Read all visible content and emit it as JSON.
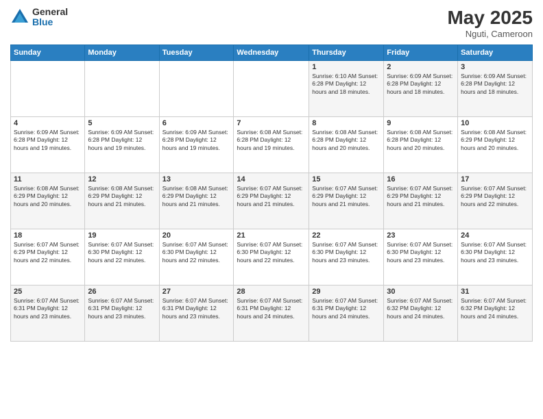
{
  "logo": {
    "general": "General",
    "blue": "Blue"
  },
  "header": {
    "month_year": "May 2025",
    "location": "Nguti, Cameroon"
  },
  "weekdays": [
    "Sunday",
    "Monday",
    "Tuesday",
    "Wednesday",
    "Thursday",
    "Friday",
    "Saturday"
  ],
  "weeks": [
    [
      {
        "day": "",
        "info": ""
      },
      {
        "day": "",
        "info": ""
      },
      {
        "day": "",
        "info": ""
      },
      {
        "day": "",
        "info": ""
      },
      {
        "day": "1",
        "info": "Sunrise: 6:10 AM\nSunset: 6:28 PM\nDaylight: 12 hours\nand 18 minutes."
      },
      {
        "day": "2",
        "info": "Sunrise: 6:09 AM\nSunset: 6:28 PM\nDaylight: 12 hours\nand 18 minutes."
      },
      {
        "day": "3",
        "info": "Sunrise: 6:09 AM\nSunset: 6:28 PM\nDaylight: 12 hours\nand 18 minutes."
      }
    ],
    [
      {
        "day": "4",
        "info": "Sunrise: 6:09 AM\nSunset: 6:28 PM\nDaylight: 12 hours\nand 19 minutes."
      },
      {
        "day": "5",
        "info": "Sunrise: 6:09 AM\nSunset: 6:28 PM\nDaylight: 12 hours\nand 19 minutes."
      },
      {
        "day": "6",
        "info": "Sunrise: 6:09 AM\nSunset: 6:28 PM\nDaylight: 12 hours\nand 19 minutes."
      },
      {
        "day": "7",
        "info": "Sunrise: 6:08 AM\nSunset: 6:28 PM\nDaylight: 12 hours\nand 19 minutes."
      },
      {
        "day": "8",
        "info": "Sunrise: 6:08 AM\nSunset: 6:28 PM\nDaylight: 12 hours\nand 20 minutes."
      },
      {
        "day": "9",
        "info": "Sunrise: 6:08 AM\nSunset: 6:28 PM\nDaylight: 12 hours\nand 20 minutes."
      },
      {
        "day": "10",
        "info": "Sunrise: 6:08 AM\nSunset: 6:29 PM\nDaylight: 12 hours\nand 20 minutes."
      }
    ],
    [
      {
        "day": "11",
        "info": "Sunrise: 6:08 AM\nSunset: 6:29 PM\nDaylight: 12 hours\nand 20 minutes."
      },
      {
        "day": "12",
        "info": "Sunrise: 6:08 AM\nSunset: 6:29 PM\nDaylight: 12 hours\nand 21 minutes."
      },
      {
        "day": "13",
        "info": "Sunrise: 6:08 AM\nSunset: 6:29 PM\nDaylight: 12 hours\nand 21 minutes."
      },
      {
        "day": "14",
        "info": "Sunrise: 6:07 AM\nSunset: 6:29 PM\nDaylight: 12 hours\nand 21 minutes."
      },
      {
        "day": "15",
        "info": "Sunrise: 6:07 AM\nSunset: 6:29 PM\nDaylight: 12 hours\nand 21 minutes."
      },
      {
        "day": "16",
        "info": "Sunrise: 6:07 AM\nSunset: 6:29 PM\nDaylight: 12 hours\nand 21 minutes."
      },
      {
        "day": "17",
        "info": "Sunrise: 6:07 AM\nSunset: 6:29 PM\nDaylight: 12 hours\nand 22 minutes."
      }
    ],
    [
      {
        "day": "18",
        "info": "Sunrise: 6:07 AM\nSunset: 6:29 PM\nDaylight: 12 hours\nand 22 minutes."
      },
      {
        "day": "19",
        "info": "Sunrise: 6:07 AM\nSunset: 6:30 PM\nDaylight: 12 hours\nand 22 minutes."
      },
      {
        "day": "20",
        "info": "Sunrise: 6:07 AM\nSunset: 6:30 PM\nDaylight: 12 hours\nand 22 minutes."
      },
      {
        "day": "21",
        "info": "Sunrise: 6:07 AM\nSunset: 6:30 PM\nDaylight: 12 hours\nand 22 minutes."
      },
      {
        "day": "22",
        "info": "Sunrise: 6:07 AM\nSunset: 6:30 PM\nDaylight: 12 hours\nand 23 minutes."
      },
      {
        "day": "23",
        "info": "Sunrise: 6:07 AM\nSunset: 6:30 PM\nDaylight: 12 hours\nand 23 minutes."
      },
      {
        "day": "24",
        "info": "Sunrise: 6:07 AM\nSunset: 6:30 PM\nDaylight: 12 hours\nand 23 minutes."
      }
    ],
    [
      {
        "day": "25",
        "info": "Sunrise: 6:07 AM\nSunset: 6:31 PM\nDaylight: 12 hours\nand 23 minutes."
      },
      {
        "day": "26",
        "info": "Sunrise: 6:07 AM\nSunset: 6:31 PM\nDaylight: 12 hours\nand 23 minutes."
      },
      {
        "day": "27",
        "info": "Sunrise: 6:07 AM\nSunset: 6:31 PM\nDaylight: 12 hours\nand 23 minutes."
      },
      {
        "day": "28",
        "info": "Sunrise: 6:07 AM\nSunset: 6:31 PM\nDaylight: 12 hours\nand 24 minutes."
      },
      {
        "day": "29",
        "info": "Sunrise: 6:07 AM\nSunset: 6:31 PM\nDaylight: 12 hours\nand 24 minutes."
      },
      {
        "day": "30",
        "info": "Sunrise: 6:07 AM\nSunset: 6:32 PM\nDaylight: 12 hours\nand 24 minutes."
      },
      {
        "day": "31",
        "info": "Sunrise: 6:07 AM\nSunset: 6:32 PM\nDaylight: 12 hours\nand 24 minutes."
      }
    ]
  ]
}
